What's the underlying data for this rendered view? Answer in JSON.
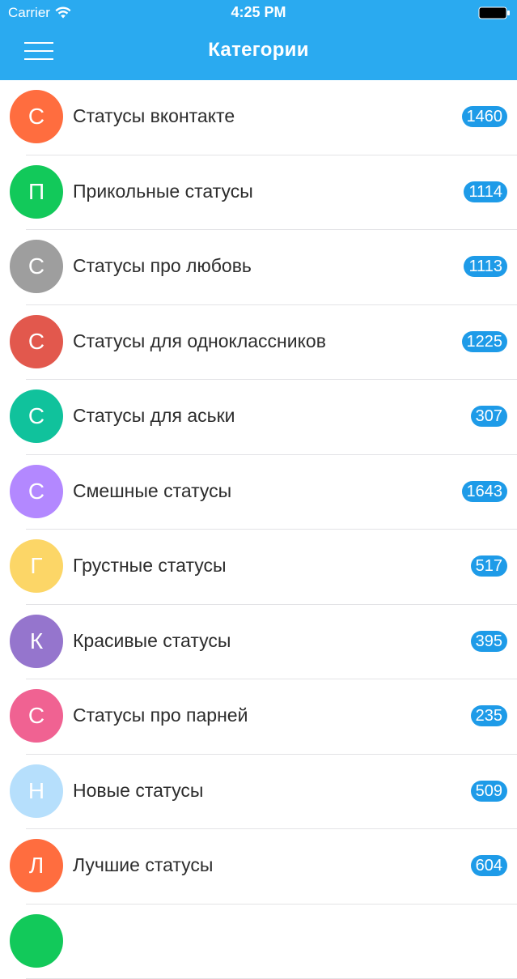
{
  "status_bar": {
    "carrier": "Carrier",
    "time": "4:25 PM",
    "wifi_icon": "wifi-icon",
    "battery_icon": "battery-icon"
  },
  "header": {
    "title": "Категории",
    "menu_icon": "hamburger-menu-icon",
    "background_color": "#2aaaf0"
  },
  "badge_color": "#1e9be8",
  "categories": [
    {
      "initial": "С",
      "label": "Статусы вконтакте",
      "count": "1460",
      "color": "#ff6d3f"
    },
    {
      "initial": "П",
      "label": "Прикольные статусы",
      "count": "1114",
      "color": "#12c95a"
    },
    {
      "initial": "С",
      "label": "Статусы про любовь",
      "count": "1113",
      "color": "#9e9e9e"
    },
    {
      "initial": "С",
      "label": "Статусы для одноклассников",
      "count": "1225",
      "color": "#e2584d"
    },
    {
      "initial": "С",
      "label": "Статусы для аськи",
      "count": "307",
      "color": "#10c29c"
    },
    {
      "initial": "С",
      "label": "Смешные статусы",
      "count": "1643",
      "color": "#b388ff"
    },
    {
      "initial": "Г",
      "label": "Грустные статусы",
      "count": "517",
      "color": "#fcd667"
    },
    {
      "initial": "К",
      "label": "Красивые статусы",
      "count": "395",
      "color": "#9575cd"
    },
    {
      "initial": "С",
      "label": "Статусы про парней",
      "count": "235",
      "color": "#f06292"
    },
    {
      "initial": "Н",
      "label": "Новые статусы",
      "count": "509",
      "color": "#b6dffc"
    },
    {
      "initial": "Л",
      "label": "Лучшие статусы",
      "count": "604",
      "color": "#ff6d3f"
    },
    {
      "initial": "",
      "label": "",
      "count": "",
      "color": "#12c95a"
    }
  ]
}
